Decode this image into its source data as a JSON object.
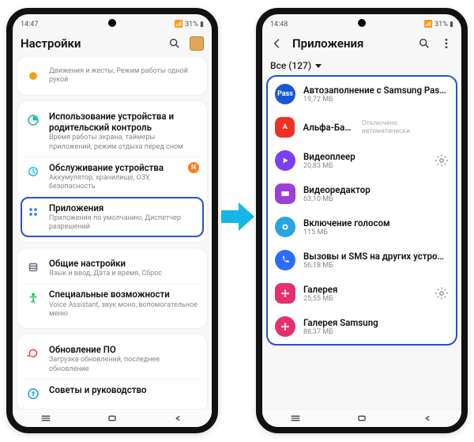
{
  "left": {
    "status_time": "14:47",
    "status_left_icons": "✉ ⓘ ⋮",
    "status_right": "📶 31% ▮",
    "appbar_title": "Настройки",
    "groups": [
      {
        "rows": [
          {
            "name": "digital-wellbeing",
            "icon": "wellbeing",
            "title": "",
            "sub": "Движения и жесты, Режим работы одной рукой"
          }
        ]
      },
      {
        "rows": [
          {
            "name": "device-usage",
            "icon": "usage",
            "title": "Использование устройства и родительский контроль",
            "sub": "Время работы экрана, таймеры приложений, режим отдыха перед сном"
          },
          {
            "name": "device-care",
            "icon": "care",
            "title": "Обслуживание устройства",
            "sub": "Аккумулятор, хранилище, ОЗУ, безопасность",
            "badge": "N"
          },
          {
            "name": "apps",
            "icon": "apps",
            "title": "Приложения",
            "sub": "Приложения по умолчанию, Диспетчер разрешений",
            "highlight": true
          }
        ]
      },
      {
        "rows": [
          {
            "name": "general",
            "icon": "general",
            "title": "Общие настройки",
            "sub": "Язык и ввод, Дата и время, Сброс"
          },
          {
            "name": "accessibility",
            "icon": "accessibility",
            "title": "Специальные возможности",
            "sub": "Voice Assistant, звук моно, вспомогательное меню"
          }
        ]
      },
      {
        "rows": [
          {
            "name": "software-update",
            "icon": "update",
            "title": "Обновление ПО",
            "sub": "Загрузка обновлений, последнее обновление"
          },
          {
            "name": "tips",
            "icon": "tips",
            "title": "Советы и руководство",
            "sub": ""
          }
        ]
      }
    ]
  },
  "right": {
    "status_time": "14:48",
    "status_left_icons": "✉ ⓘ ⋮",
    "status_right": "📶 31% ▮",
    "appbar_title": "Приложения",
    "chip_label": "Все (127)",
    "disabled_label": "Отключено автоматически",
    "apps": [
      {
        "name": "autofill",
        "title": "Автозаполнение с Samsung Pas…",
        "sub": "19,72 МБ",
        "color": "#1a56d6",
        "shape": "round",
        "glyph": "Pass",
        "gear": false
      },
      {
        "name": "alfa-bank",
        "title": "Альфа-Банк",
        "sub": "",
        "color": "#ef3124",
        "shape": "square",
        "glyph": "A",
        "gear": false,
        "disabled": true
      },
      {
        "name": "video-player",
        "title": "Видеоплеер",
        "sub": "20,83 МБ",
        "color": "#7b3ff2",
        "shape": "round",
        "glyph": "play",
        "gear": true
      },
      {
        "name": "video-editor",
        "title": "Видеоредактор",
        "sub": "63,10 МБ",
        "color": "#9b3fd6",
        "shape": "square",
        "glyph": "film",
        "gear": false
      },
      {
        "name": "voice-wakeup",
        "title": "Включение голосом",
        "sub": "115 МБ",
        "color": "#27a5e0",
        "shape": "round",
        "glyph": "bixby",
        "gear": false
      },
      {
        "name": "calls-sms",
        "title": "Вызовы и SMS на других устро…",
        "sub": "56,18 МБ",
        "color": "#2b6cff",
        "shape": "round",
        "glyph": "phone",
        "gear": false
      },
      {
        "name": "gallery",
        "title": "Галерея",
        "sub": "25,55 МБ",
        "color": "#e5316b",
        "shape": "square",
        "glyph": "flower",
        "gear": true
      },
      {
        "name": "gallery-vr",
        "title": "Галерея Samsung",
        "sub": "88,37 МБ",
        "color": "#e5316b",
        "shape": "round",
        "glyph": "flower",
        "gear": false
      }
    ]
  }
}
